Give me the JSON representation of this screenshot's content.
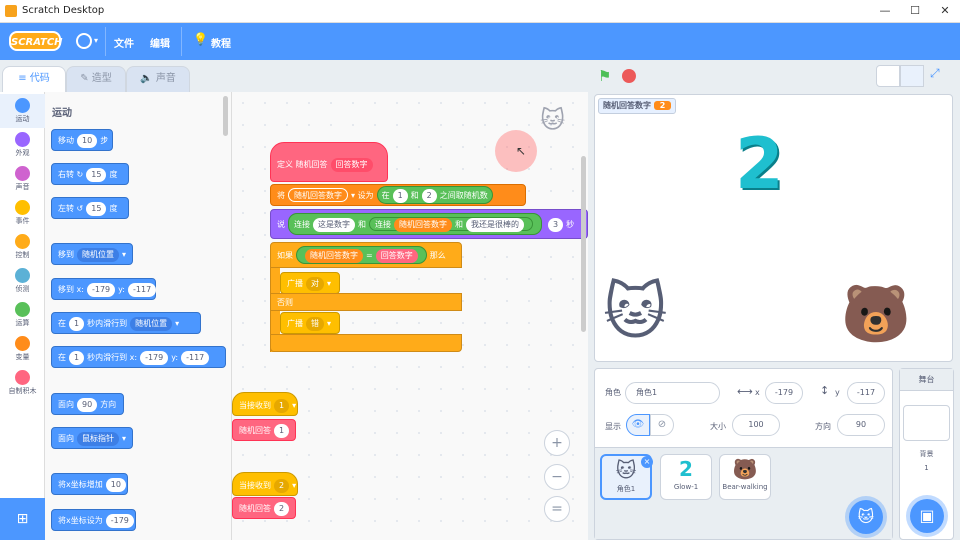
{
  "window": {
    "title": "Scratch Desktop",
    "minimize": "—",
    "maximize": "☐",
    "close": "✕"
  },
  "menu": {
    "logo": "SCRATCH",
    "file": "文件",
    "edit": "编辑",
    "tutorials": "教程"
  },
  "tabs": {
    "code": "代码",
    "costumes": "造型",
    "sounds": "声音"
  },
  "categories": [
    {
      "label": "运动",
      "color": "#4c97ff"
    },
    {
      "label": "外观",
      "color": "#9966ff"
    },
    {
      "label": "声音",
      "color": "#cf63cf"
    },
    {
      "label": "事件",
      "color": "#ffbf00"
    },
    {
      "label": "控制",
      "color": "#ffab19"
    },
    {
      "label": "侦测",
      "color": "#5cb1d6"
    },
    {
      "label": "运算",
      "color": "#59c059"
    },
    {
      "label": "变量",
      "color": "#ff8c1a"
    },
    {
      "label": "自制积木",
      "color": "#ff6680"
    }
  ],
  "palette": {
    "heading": "运动",
    "move": "移动",
    "move_val": "10",
    "move_unit": "步",
    "turn_right": "右转",
    "turn_right_val": "15",
    "turn_left": "左转",
    "turn_left_val": "15",
    "deg": "度",
    "goto": "移到",
    "goto_target": "随机位置",
    "goto_xy": "移到 x:",
    "x_val": "-179",
    "y_lbl": "y:",
    "y_val": "-117",
    "glide": "在",
    "glide_sec": "1",
    "glide_text": "秒内滑行到",
    "glide_target": "随机位置",
    "glide_xy_text": "秒内滑行到 x:",
    "point": "面向",
    "point_val": "90",
    "point_unit": "方向",
    "point_to": "面向",
    "point_to_target": "鼠标指针",
    "change_x": "将x坐标增加",
    "change_x_val": "10",
    "set_x": "将x坐标设为",
    "set_x_val": "-179"
  },
  "script": {
    "define": "定义",
    "define_name": "随机回答",
    "define_param": "回答数字",
    "set": "将",
    "set_var": "随机回答数字",
    "set_to": "设为",
    "rand_from": "在",
    "rand_a": "1",
    "rand_and": "和",
    "rand_b": "2",
    "rand_text": "之间取随机数",
    "say": "说",
    "join1": "连接",
    "join_text1": "这是数字",
    "join_and": "和",
    "join2": "连接",
    "join_var": "随机回答数字",
    "join_text2": "我还是很棒的",
    "say_secs": "3",
    "say_secs_unit": "秒",
    "if": "如果",
    "cond_left": "随机回答数字",
    "cond_op": "=",
    "cond_right": "回答数字",
    "then": "那么",
    "broadcast": "广播",
    "broadcast_right": "对",
    "else": "否则",
    "broadcast_wrong": "错",
    "hat1": "当接收到",
    "hat1_msg": "1",
    "call1": "随机回答",
    "call1_val": "1",
    "hat2": "当接收到",
    "hat2_msg": "2",
    "call2": "随机回答",
    "call2_val": "2"
  },
  "stage": {
    "monitor_label": "随机回答数字",
    "monitor_value": "2",
    "big_number": "2"
  },
  "sprite_info": {
    "sprite_label": "角色",
    "sprite_name": "角色1",
    "x_label": "x",
    "x": "-179",
    "y_label": "y",
    "y": "-117",
    "show_label": "显示",
    "size_label": "大小",
    "size": "100",
    "direction_label": "方向",
    "direction": "90"
  },
  "sprites": [
    {
      "name": "角色1"
    },
    {
      "name": "Glow-1"
    },
    {
      "name": "Bear-walking"
    }
  ],
  "stage_panel": {
    "title": "舞台",
    "backdrops_label": "背景",
    "backdrops_count": "1"
  },
  "zoom": {
    "in": "+",
    "out": "−",
    "reset": "="
  }
}
